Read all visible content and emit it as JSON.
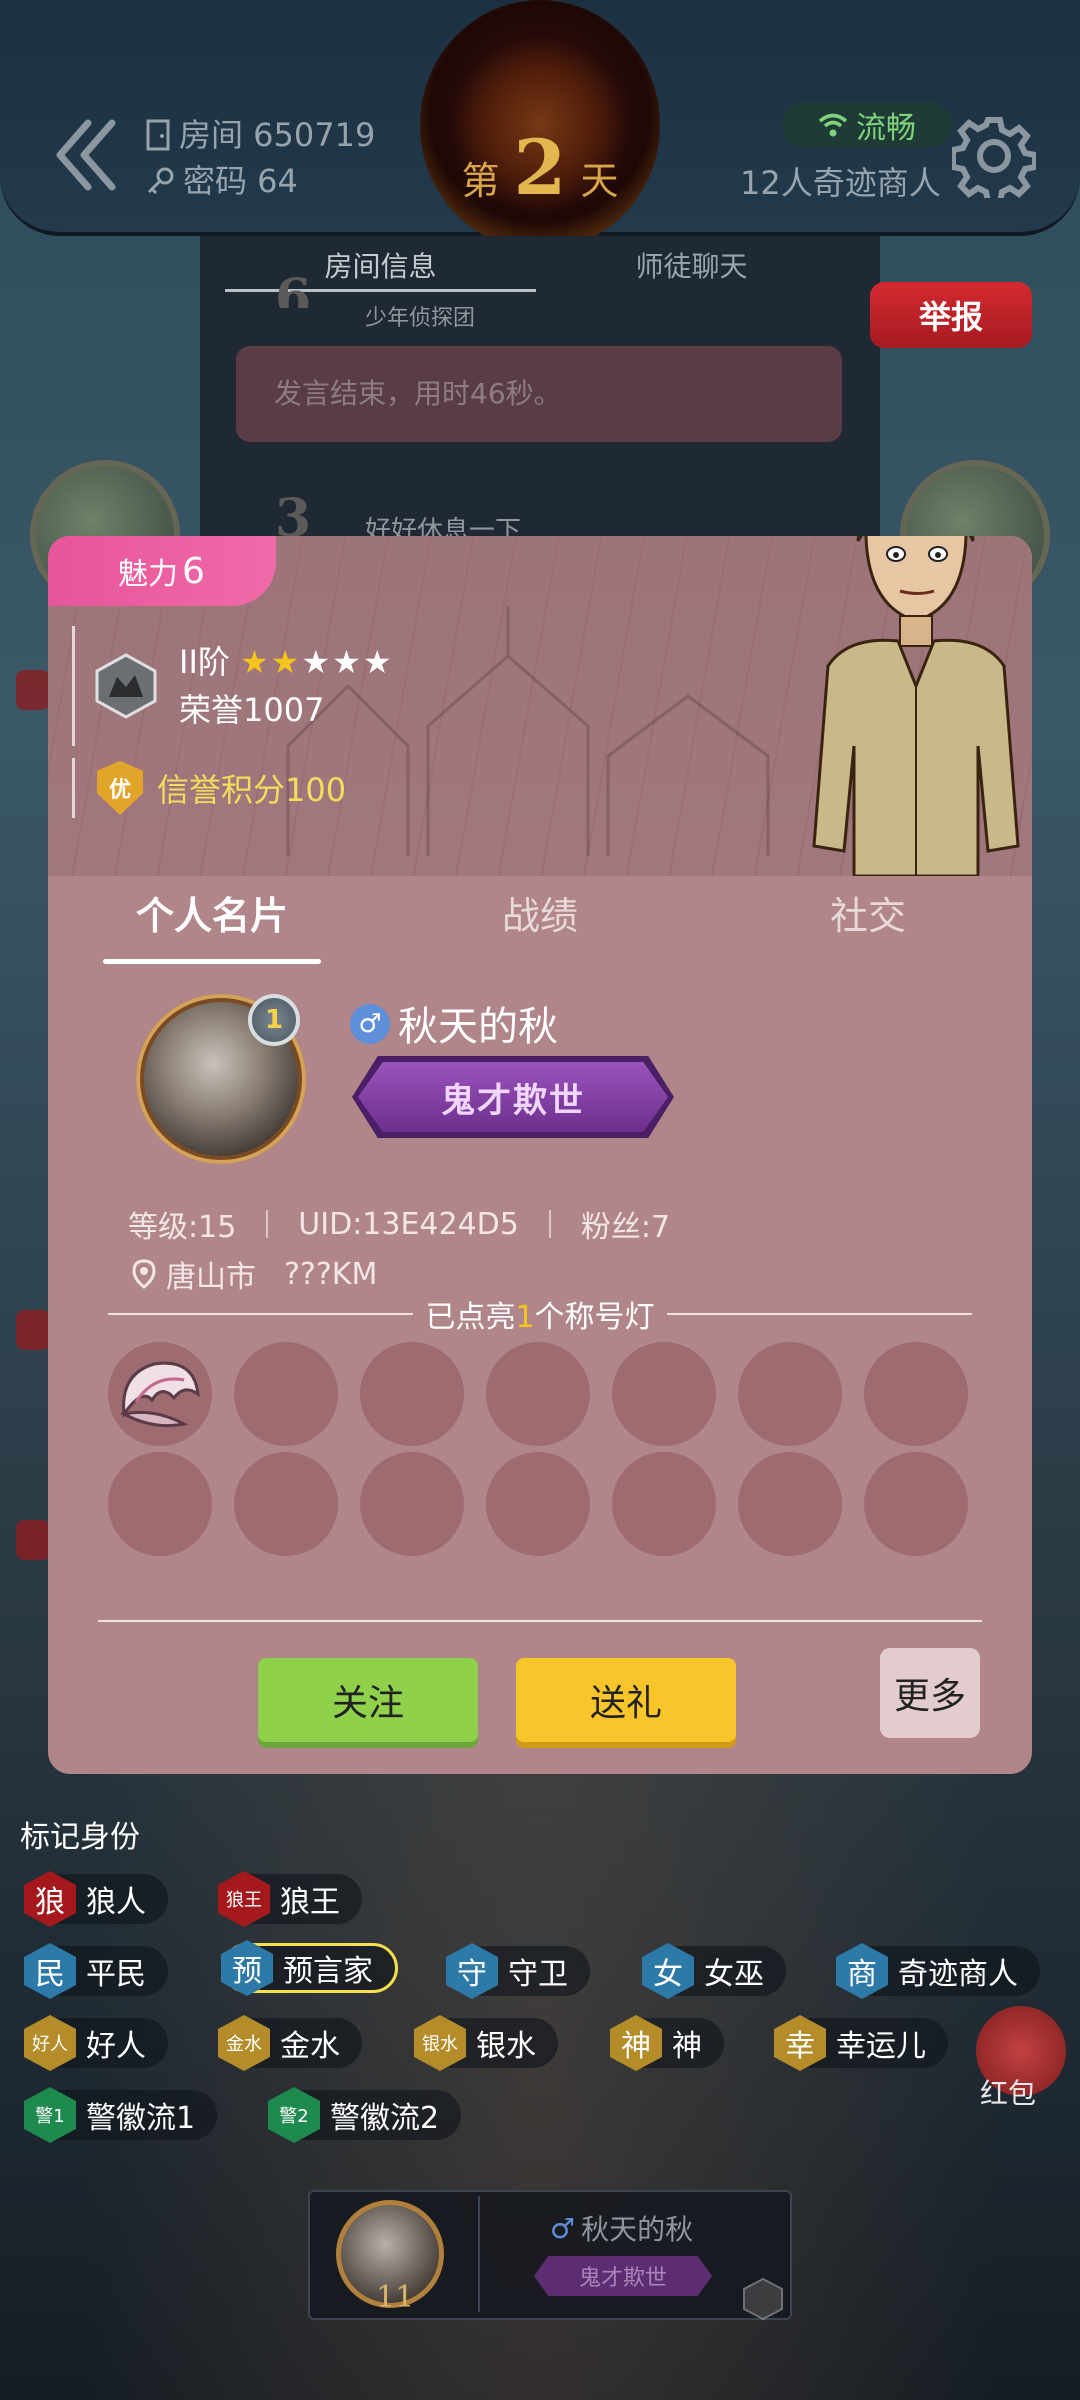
{
  "header": {
    "room_label": "房间 650719",
    "password_label": "密码 64",
    "day_prefix": "第",
    "day_number": "2",
    "day_suffix": "天",
    "network_status": "流畅",
    "game_mode": "12人奇迹商人"
  },
  "chat": {
    "tabs": [
      "房间信息",
      "师徒聊天"
    ],
    "active_tab": "房间信息",
    "entry1": {
      "number": "6",
      "sender": "少年侦探团",
      "message": "发言结束，用时46秒。"
    },
    "entry2": {
      "number": "3",
      "sender": "好好休息一下"
    },
    "report_label": "举报"
  },
  "profile": {
    "charm_label": "魅力",
    "charm_value": "6",
    "rank": "II阶",
    "rank_stars_filled": 2,
    "rank_stars_total": 5,
    "honor_label": "荣誉1007",
    "credit_badge": "优",
    "credit_label": "信誉积分100",
    "tabs": [
      "个人名片",
      "战绩",
      "社交"
    ],
    "active_tab": "个人名片",
    "avatar_level": "1",
    "gender_symbol": "♂",
    "nickname": "秋天的秋",
    "title": "鬼才欺世",
    "level": "等级:15",
    "uid": "UID:13E424D5",
    "fans": "粉丝:7",
    "location_city": "唐山市",
    "location_distance": "???KM",
    "lamps_prefix": "已点亮",
    "lamps_count": "1",
    "lamps_suffix": "个称号灯",
    "lamps_lit": 1,
    "lamps_total": 14,
    "follow_label": "关注",
    "gift_label": "送礼",
    "more_label": "更多"
  },
  "identity_panel": {
    "title": "标记身份",
    "tags": [
      {
        "badge": "狼",
        "label": "狼人",
        "color": "red"
      },
      {
        "badge": "狼王",
        "label": "狼王",
        "color": "red"
      },
      {
        "badge": "民",
        "label": "平民",
        "color": "blue"
      },
      {
        "badge": "预",
        "label": "预言家",
        "color": "blue",
        "selected": true
      },
      {
        "badge": "守",
        "label": "守卫",
        "color": "blue"
      },
      {
        "badge": "女",
        "label": "女巫",
        "color": "blue"
      },
      {
        "badge": "商",
        "label": "奇迹商人",
        "color": "blue"
      },
      {
        "badge": "好人",
        "label": "好人",
        "color": "gold"
      },
      {
        "badge": "金水",
        "label": "金水",
        "color": "gold"
      },
      {
        "badge": "银水",
        "label": "银水",
        "color": "gold"
      },
      {
        "badge": "神",
        "label": "神",
        "color": "gold"
      },
      {
        "badge": "幸",
        "label": "幸运儿",
        "color": "gold"
      },
      {
        "badge": "警1",
        "label": "警徽流1",
        "color": "green"
      },
      {
        "badge": "警2",
        "label": "警徽流2",
        "color": "green"
      }
    ],
    "redpack_label": "红包"
  },
  "player_strip": {
    "seat": "11",
    "gender_symbol": "♂",
    "name": "秋天的秋",
    "title": "鬼才欺世"
  },
  "colors": {
    "card_bg": "#b0868a",
    "charm_pink": "#e7559a",
    "follow_green": "#8fd14a",
    "gift_yellow": "#f8c52a",
    "report_red": "#d42a30",
    "title_purple": "#9a54bd"
  }
}
